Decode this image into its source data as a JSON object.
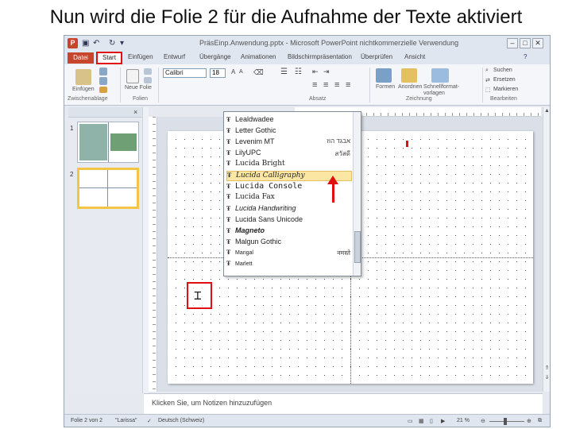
{
  "caption": "Nun wird die Folie 2 für die Aufnahme der Texte aktiviert",
  "window": {
    "title": "PräsEinp.Anwendung.pptx - Microsoft PowerPoint nichtkommerzielle Verwendung",
    "app_icon": "P",
    "controls": [
      "–",
      "□",
      "✕"
    ]
  },
  "tabs": [
    "Datei",
    "Start",
    "Einfügen",
    "Entwurf",
    "Übergänge",
    "Animationen",
    "Bildschirmpräsentation",
    "Überprüfen",
    "Ansicht"
  ],
  "ribbon": {
    "groups": [
      "Zwischenablage",
      "Folien",
      "Absatz",
      "Zeichnung",
      "Bearbeiten"
    ],
    "paste_label": "Einfügen",
    "new_slide_label": "Neue Folie",
    "font_value": "Calibri",
    "size_value": "18",
    "shapes_label": "Formen",
    "arrange_label": "Anordnen",
    "quickstyles_label": "Schnellformat-vorlagen",
    "find_label": "Suchen",
    "replace_label": "Ersetzen",
    "select_label": "Markieren"
  },
  "font_list": [
    {
      "name": "Lealdwadee",
      "sample": ""
    },
    {
      "name": "Letter Gothic",
      "sample": ""
    },
    {
      "name": "Levenim MT",
      "sample": "אבגד הוז"
    },
    {
      "name": "LilyUPC",
      "sample": "สวัสดี"
    },
    {
      "name": "Lucida Bright",
      "sample": ""
    },
    {
      "name": "Lucida Calligraphy",
      "sample": "",
      "highlighted": true
    },
    {
      "name": "Lucida Console",
      "sample": ""
    },
    {
      "name": "Lucida Fax",
      "sample": ""
    },
    {
      "name": "Lucida Handwriting",
      "sample": ""
    },
    {
      "name": "Lucida Sans Unicode",
      "sample": ""
    },
    {
      "name": "Magneto",
      "sample": ""
    },
    {
      "name": "Malgun Gothic",
      "sample": ""
    },
    {
      "name": "Mangal",
      "sample": "नमस्ते"
    },
    {
      "name": "Marlett",
      "sample": ""
    }
  ],
  "slides_panel": {
    "close": "×",
    "slides": [
      {
        "number": "1"
      },
      {
        "number": "2",
        "selected": true
      }
    ]
  },
  "notes_placeholder": "Klicken Sie, um Notizen hinzuzufügen",
  "status": {
    "slide": "Folie 2 von 2",
    "theme": "\"Larissa\"",
    "language": "Deutsch (Schweiz)",
    "zoom": "21 %"
  },
  "colors": {
    "accent_red": "#e01010",
    "file_tab": "#c8442a",
    "highlight": "#fbe7a3"
  }
}
